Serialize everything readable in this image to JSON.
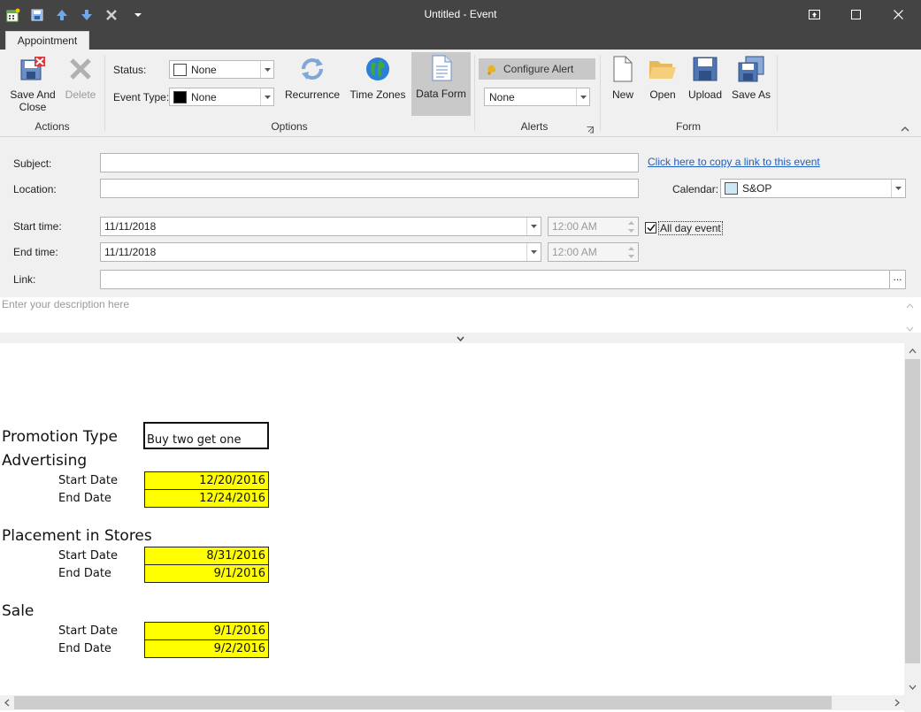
{
  "window": {
    "title": "Untitled - Event"
  },
  "tabs": [
    {
      "label": "Appointment"
    }
  ],
  "ribbon": {
    "actions": {
      "save_close_line1": "Save And",
      "save_close_line2": "Close",
      "delete": "Delete",
      "group": "Actions"
    },
    "options": {
      "status_label": "Status:",
      "status_value": "None",
      "event_type_label": "Event Type:",
      "event_type_value": "None",
      "recurrence": "Recurrence",
      "time_zones": "Time Zones",
      "data_form": "Data Form",
      "group": "Options"
    },
    "alerts": {
      "configure_alert": "Configure Alert",
      "alert_value": "None",
      "group": "Alerts"
    },
    "form": {
      "new": "New",
      "open": "Open",
      "upload": "Upload",
      "save_as": "Save As",
      "group": "Form"
    }
  },
  "event_form": {
    "subject_label": "Subject:",
    "subject_value": "",
    "copy_link_text": "Click here to copy a link to this event",
    "location_label": "Location:",
    "location_value": "",
    "calendar_label": "Calendar:",
    "calendar_value": "S&OP",
    "start_label": "Start time:",
    "start_date": "11/11/2018",
    "start_time": "12:00 AM",
    "all_day_label": "All day event",
    "all_day_checked": true,
    "end_label": "End time:",
    "end_date": "11/11/2018",
    "end_time": "12:00 AM",
    "link_label": "Link:",
    "link_value": "",
    "link_browse": "...",
    "description_placeholder": "Enter your description here"
  },
  "data_form_sheet": {
    "promotion_type_label": "Promotion Type",
    "promotion_type_value": "Buy two get one",
    "sections": [
      {
        "title": "Advertising",
        "start_label": "Start Date",
        "start_value": "12/20/2016",
        "end_label": "End Date",
        "end_value": "12/24/2016"
      },
      {
        "title": "Placement in Stores",
        "start_label": "Start Date",
        "start_value": "8/31/2016",
        "end_label": "End Date",
        "end_value": "9/1/2016"
      },
      {
        "title": "Sale",
        "start_label": "Start Date",
        "start_value": "9/1/2016",
        "end_label": "End Date",
        "end_value": "9/2/2016"
      }
    ],
    "cell_highlight_color": "#ffff00"
  },
  "colors": {
    "titlebar": "#444444",
    "ribbon_bg": "#f0f0f0",
    "link": "#1f5fbf"
  }
}
